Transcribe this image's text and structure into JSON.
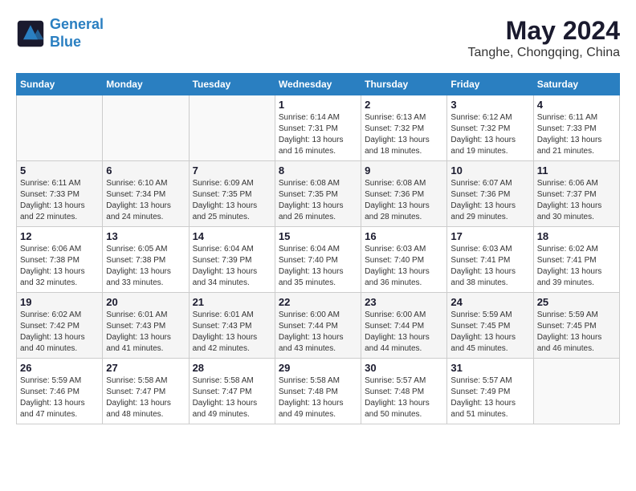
{
  "logo": {
    "line1": "General",
    "line2": "Blue"
  },
  "title": "May 2024",
  "subtitle": "Tanghe, Chongqing, China",
  "weekdays": [
    "Sunday",
    "Monday",
    "Tuesday",
    "Wednesday",
    "Thursday",
    "Friday",
    "Saturday"
  ],
  "weeks": [
    [
      {
        "day": "",
        "info": ""
      },
      {
        "day": "",
        "info": ""
      },
      {
        "day": "",
        "info": ""
      },
      {
        "day": "1",
        "info": "Sunrise: 6:14 AM\nSunset: 7:31 PM\nDaylight: 13 hours and 16 minutes."
      },
      {
        "day": "2",
        "info": "Sunrise: 6:13 AM\nSunset: 7:32 PM\nDaylight: 13 hours and 18 minutes."
      },
      {
        "day": "3",
        "info": "Sunrise: 6:12 AM\nSunset: 7:32 PM\nDaylight: 13 hours and 19 minutes."
      },
      {
        "day": "4",
        "info": "Sunrise: 6:11 AM\nSunset: 7:33 PM\nDaylight: 13 hours and 21 minutes."
      }
    ],
    [
      {
        "day": "5",
        "info": "Sunrise: 6:11 AM\nSunset: 7:33 PM\nDaylight: 13 hours and 22 minutes."
      },
      {
        "day": "6",
        "info": "Sunrise: 6:10 AM\nSunset: 7:34 PM\nDaylight: 13 hours and 24 minutes."
      },
      {
        "day": "7",
        "info": "Sunrise: 6:09 AM\nSunset: 7:35 PM\nDaylight: 13 hours and 25 minutes."
      },
      {
        "day": "8",
        "info": "Sunrise: 6:08 AM\nSunset: 7:35 PM\nDaylight: 13 hours and 26 minutes."
      },
      {
        "day": "9",
        "info": "Sunrise: 6:08 AM\nSunset: 7:36 PM\nDaylight: 13 hours and 28 minutes."
      },
      {
        "day": "10",
        "info": "Sunrise: 6:07 AM\nSunset: 7:36 PM\nDaylight: 13 hours and 29 minutes."
      },
      {
        "day": "11",
        "info": "Sunrise: 6:06 AM\nSunset: 7:37 PM\nDaylight: 13 hours and 30 minutes."
      }
    ],
    [
      {
        "day": "12",
        "info": "Sunrise: 6:06 AM\nSunset: 7:38 PM\nDaylight: 13 hours and 32 minutes."
      },
      {
        "day": "13",
        "info": "Sunrise: 6:05 AM\nSunset: 7:38 PM\nDaylight: 13 hours and 33 minutes."
      },
      {
        "day": "14",
        "info": "Sunrise: 6:04 AM\nSunset: 7:39 PM\nDaylight: 13 hours and 34 minutes."
      },
      {
        "day": "15",
        "info": "Sunrise: 6:04 AM\nSunset: 7:40 PM\nDaylight: 13 hours and 35 minutes."
      },
      {
        "day": "16",
        "info": "Sunrise: 6:03 AM\nSunset: 7:40 PM\nDaylight: 13 hours and 36 minutes."
      },
      {
        "day": "17",
        "info": "Sunrise: 6:03 AM\nSunset: 7:41 PM\nDaylight: 13 hours and 38 minutes."
      },
      {
        "day": "18",
        "info": "Sunrise: 6:02 AM\nSunset: 7:41 PM\nDaylight: 13 hours and 39 minutes."
      }
    ],
    [
      {
        "day": "19",
        "info": "Sunrise: 6:02 AM\nSunset: 7:42 PM\nDaylight: 13 hours and 40 minutes."
      },
      {
        "day": "20",
        "info": "Sunrise: 6:01 AM\nSunset: 7:43 PM\nDaylight: 13 hours and 41 minutes."
      },
      {
        "day": "21",
        "info": "Sunrise: 6:01 AM\nSunset: 7:43 PM\nDaylight: 13 hours and 42 minutes."
      },
      {
        "day": "22",
        "info": "Sunrise: 6:00 AM\nSunset: 7:44 PM\nDaylight: 13 hours and 43 minutes."
      },
      {
        "day": "23",
        "info": "Sunrise: 6:00 AM\nSunset: 7:44 PM\nDaylight: 13 hours and 44 minutes."
      },
      {
        "day": "24",
        "info": "Sunrise: 5:59 AM\nSunset: 7:45 PM\nDaylight: 13 hours and 45 minutes."
      },
      {
        "day": "25",
        "info": "Sunrise: 5:59 AM\nSunset: 7:45 PM\nDaylight: 13 hours and 46 minutes."
      }
    ],
    [
      {
        "day": "26",
        "info": "Sunrise: 5:59 AM\nSunset: 7:46 PM\nDaylight: 13 hours and 47 minutes."
      },
      {
        "day": "27",
        "info": "Sunrise: 5:58 AM\nSunset: 7:47 PM\nDaylight: 13 hours and 48 minutes."
      },
      {
        "day": "28",
        "info": "Sunrise: 5:58 AM\nSunset: 7:47 PM\nDaylight: 13 hours and 49 minutes."
      },
      {
        "day": "29",
        "info": "Sunrise: 5:58 AM\nSunset: 7:48 PM\nDaylight: 13 hours and 49 minutes."
      },
      {
        "day": "30",
        "info": "Sunrise: 5:57 AM\nSunset: 7:48 PM\nDaylight: 13 hours and 50 minutes."
      },
      {
        "day": "31",
        "info": "Sunrise: 5:57 AM\nSunset: 7:49 PM\nDaylight: 13 hours and 51 minutes."
      },
      {
        "day": "",
        "info": ""
      }
    ]
  ]
}
